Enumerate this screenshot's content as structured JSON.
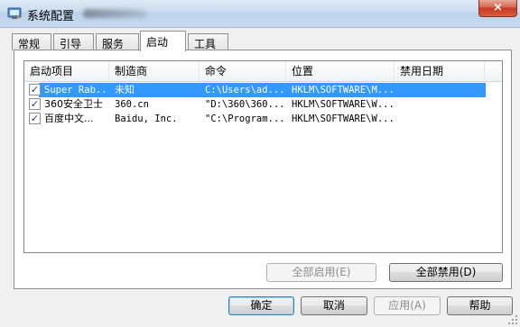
{
  "window": {
    "title": "系统配置",
    "close_label": "×"
  },
  "tabs": [
    "常规",
    "引导",
    "服务",
    "启动",
    "工具"
  ],
  "active_tab": "启动",
  "listview": {
    "columns": [
      "启动项目",
      "制造商",
      "命令",
      "位置",
      "禁用日期"
    ],
    "rows": [
      {
        "checked": true,
        "item": "Super Rab...",
        "maker": "未知",
        "command": "C:\\Users\\ad...",
        "location": "HKLM\\SOFTWARE\\M...",
        "disabled_date": "",
        "selected": true
      },
      {
        "checked": true,
        "item": "360安全卫士",
        "maker": "360.cn",
        "command": "\"D:\\360\\360...",
        "location": "HKLM\\SOFTWARE\\W...",
        "disabled_date": "",
        "selected": false
      },
      {
        "checked": true,
        "item": "百度中文...",
        "maker": "Baidu, Inc.",
        "command": "\"C:\\Program...",
        "location": "HKLM\\SOFTWARE\\W...",
        "disabled_date": "",
        "selected": false
      }
    ]
  },
  "buttons": {
    "enable_all": "全部启用(E)",
    "disable_all": "全部禁用(D)",
    "ok": "确定",
    "cancel": "取消",
    "apply": "应用(A)",
    "help": "帮助"
  },
  "colors": {
    "selection": "#3399ff",
    "close_button": "#c7371e"
  }
}
